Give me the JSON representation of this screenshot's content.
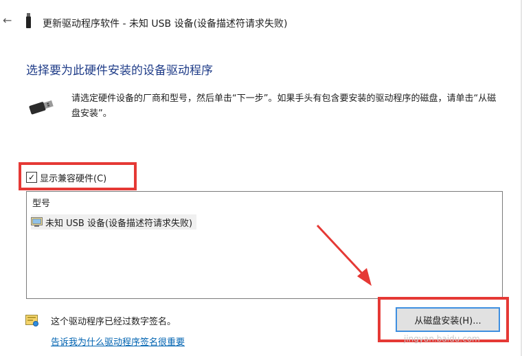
{
  "window": {
    "title": "更新驱动程序软件 - 未知 USB 设备(设备描述符请求失败)",
    "back_glyph": "←"
  },
  "main": {
    "heading": "选择要为此硬件安装的设备驱动程序",
    "description": "请选定硬件设备的厂商和型号，然后单击“下一步”。如果手头有包含要安装的驱动程序的磁盘，请单击“从磁盘安装”。"
  },
  "compat_checkbox": {
    "label": "显示兼容硬件(C)",
    "checked": true,
    "check_glyph": "✓"
  },
  "model_list": {
    "header": "型号",
    "items": [
      {
        "label": "未知 USB 设备(设备描述符请求失败)",
        "icon": "device-icon"
      }
    ]
  },
  "footer": {
    "signed_text": "这个驱动程序已经过数字签名。",
    "signed_icon": "certificate-icon",
    "link_text": "告诉我为什么驱动程序签名很重要",
    "install_button": "从磁盘安装(H)..."
  },
  "annotations": {
    "highlight_color": "#e53935",
    "watermark": "jingyan.baidu.com"
  },
  "colors": {
    "heading": "#1f3c88",
    "link": "#0063b1",
    "button_focus_border": "#3d8ee0"
  }
}
